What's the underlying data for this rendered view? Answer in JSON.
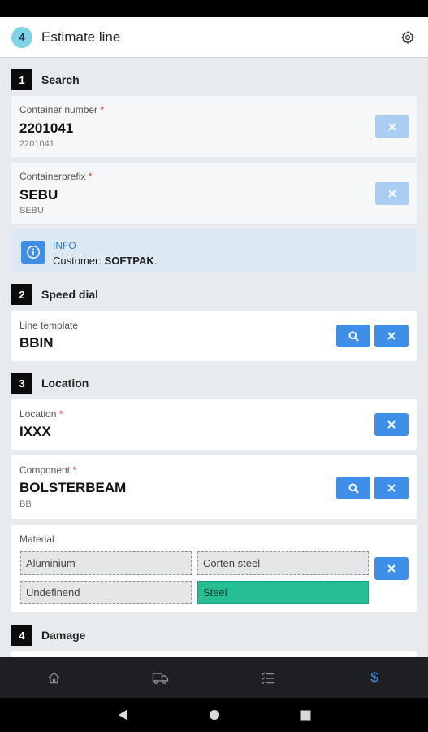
{
  "header": {
    "step_number": "4",
    "title": "Estimate line"
  },
  "sections": {
    "search": {
      "number": "1",
      "title": "Search"
    },
    "speed_dial": {
      "number": "2",
      "title": "Speed dial"
    },
    "location": {
      "number": "3",
      "title": "Location"
    },
    "damage": {
      "number": "4",
      "title": "Damage"
    }
  },
  "container_number": {
    "label": "Container number",
    "required_mark": "*",
    "value": "2201041",
    "sub": "2201041"
  },
  "container_prefix": {
    "label": "Containerprefix",
    "required_mark": "*",
    "value": "SEBU",
    "sub": "SEBU"
  },
  "info": {
    "title": "INFO",
    "text_prefix": "Customer:",
    "customer": "SOFTPAK",
    "suffix": "."
  },
  "line_template": {
    "label": "Line template",
    "value": "BBIN"
  },
  "location_field": {
    "label": "Location",
    "required_mark": "*",
    "value": "IXXX"
  },
  "component": {
    "label": "Component",
    "required_mark": "*",
    "value": "BOLSTERBEAM",
    "sub": "BB"
  },
  "material": {
    "label": "Material",
    "options": [
      "Aluminium",
      "Corten steel",
      "Undefinend",
      "Steel"
    ],
    "selected": "Steel"
  },
  "colors": {
    "accent": "#3f8fe8",
    "selected_chip": "#25bf93",
    "step_circle": "#7fd3e6"
  },
  "icons": {
    "settings": "gear-icon",
    "search": "search-icon",
    "clear": "close-icon",
    "info": "info-icon",
    "nav": [
      "home-icon",
      "truck-icon",
      "checklist-icon",
      "dollar-icon"
    ],
    "system": [
      "back-icon",
      "home-circle-icon",
      "recents-icon"
    ]
  },
  "bottom_nav": {
    "active_symbol": "$"
  }
}
